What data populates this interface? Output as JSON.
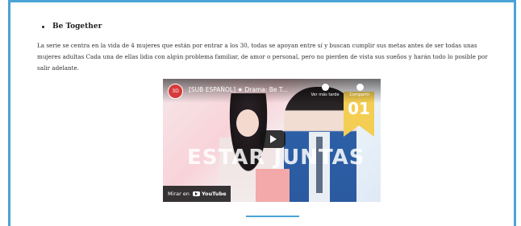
{
  "section": {
    "heading": "Be Together",
    "description": "La serie se centra en la vida de 4 mujeres que están por entrar a los 30, todas se apoyan entre sí y buscan cumplir sus metas antes de ser todas unas mujeres adultas Cada una de ellas lidia con algún problema familiar, de amor o personal, pero no pierden de vista sus sueños y harán todo lo posible por salir adelante."
  },
  "video": {
    "title": "[SUB ESPAÑOL] ★ Drama: Be T...",
    "watch_later_label": "Ver más tarde",
    "share_label": "Compartir",
    "overlay_title": "ESTAR JUNTAS",
    "episode_badge": "01",
    "watch_on_label": "Mirar en",
    "youtube_label": "YouTube",
    "channel_icon_text": "3D"
  },
  "colors": {
    "accent": "#4aa3d6",
    "badge": "#f4ce52"
  }
}
